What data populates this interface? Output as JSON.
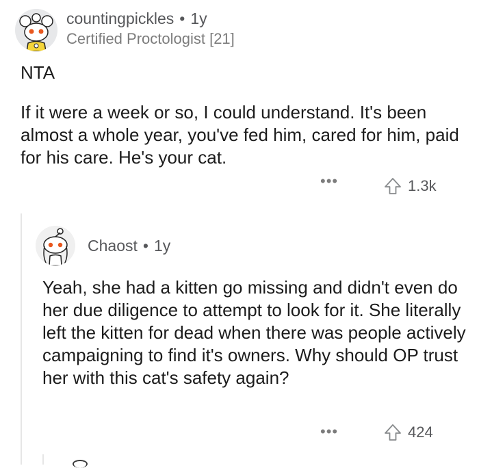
{
  "comment1": {
    "username": "countingpickles",
    "separator": "•",
    "age": "1y",
    "flair": "Certified Proctologist [21]",
    "verdict": "NTA",
    "body": "If it were a week or so,  I could understand.  It's been almost a whole year,  you've fed him,  cared for him,  paid for his care. He's your cat.",
    "more_label": "•••",
    "upvotes": "1.3k",
    "avatar_icon": "snoo-avatar-koala-icon"
  },
  "comment2": {
    "username": "Chaost",
    "separator": "•",
    "age": "1y",
    "body": "Yeah, she had a kitten go missing and didn't even do her due diligence to attempt to look for it. She literally left the kitten for dead when there was people actively campaigning to find it's owners. Why should OP trust her with this cat's safety again?",
    "more_label": "•••",
    "upvotes": "424",
    "avatar_icon": "snoo-avatar-default-icon"
  },
  "colors": {
    "text": "#1c1c1c",
    "meta": "#56575a",
    "flair": "#7c7c7c",
    "thread_line": "#e6e6e6",
    "avatar_accent": "#e8571e"
  }
}
